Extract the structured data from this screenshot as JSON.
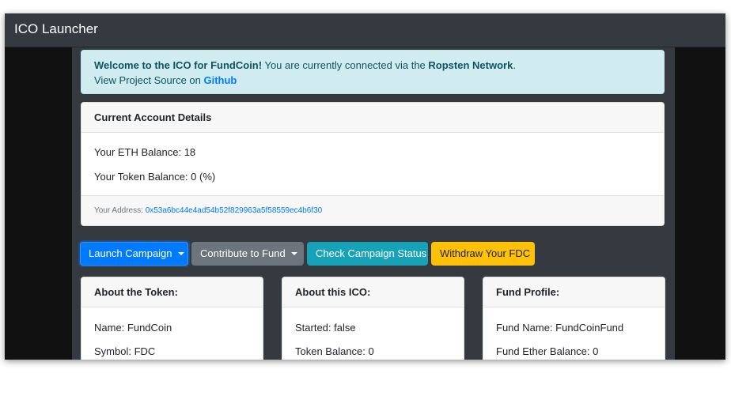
{
  "window": {
    "title": "ICO Launcher"
  },
  "alert": {
    "welcome": "Welcome to the ICO for FundCoin!",
    "connected_text": " You are currently connected via the ",
    "network": "Ropsten Network",
    "period": ".",
    "source_text": "View Project Source on ",
    "source_link": "Github"
  },
  "account": {
    "header": "Current Account Details",
    "eth_balance": "Your ETH Balance: 18",
    "token_balance": "Your Token Balance: 0 (%)",
    "address_label": "Your Address: ",
    "address": "0x53a6bc44e4ad54b52f829963a5f58559ec4b6f30"
  },
  "buttons": {
    "launch": "Launch Campaign",
    "contribute": "Contribute to Fund",
    "status": "Check Campaign Status",
    "withdraw": "Withdraw Your FDC"
  },
  "colors": {
    "primary": "#007bff",
    "secondary": "#6c757d",
    "info": "#17a2b8",
    "warning": "#ffc107",
    "alert_bg": "#d1ecf1"
  },
  "cards": {
    "token": {
      "header": "About the Token:",
      "lines": [
        "Name: FundCoin",
        "Symbol: FDC"
      ]
    },
    "ico": {
      "header": "About this ICO:",
      "lines": [
        "Started: false",
        "Token Balance: 0"
      ]
    },
    "fund": {
      "header": "Fund Profile:",
      "lines": [
        "Fund Name: FundCoinFund",
        "Fund Ether Balance: 0"
      ]
    }
  }
}
